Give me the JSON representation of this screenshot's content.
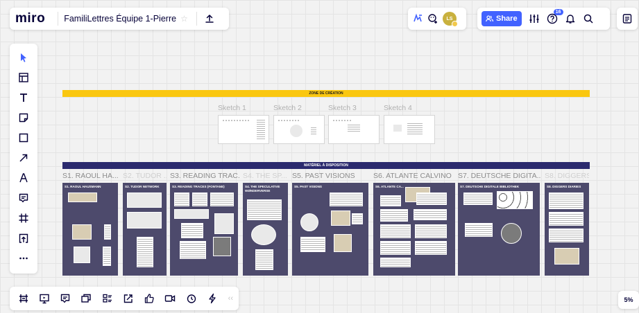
{
  "app": {
    "logo": "miro",
    "board_title": "FamiliLettres Équipe 1-Pierre"
  },
  "header": {
    "avatar_initials": "LS",
    "share_label": "Share",
    "help_badge": "16"
  },
  "toolbar": {
    "tools": [
      "select-icon",
      "templates-icon",
      "text-icon",
      "sticky-note-icon",
      "shape-icon",
      "arrow-icon",
      "pen-icon",
      "comment-icon",
      "frame-icon",
      "upload-icon",
      "more-icon"
    ]
  },
  "bottom_bar": {
    "tools": [
      "frames-icon",
      "presentation-icon",
      "comment-list-icon",
      "cards-icon",
      "kanban-icon",
      "share-screen-icon",
      "like-icon",
      "video-icon",
      "timer-icon",
      "power-icon"
    ],
    "collapse": "‹‹",
    "zoom": "5%"
  },
  "board": {
    "zone_label": "ZONE DE CRÉATION",
    "materiel_label": "MATÉRIEL À DISPOSITION",
    "sketches": [
      {
        "label": "Sketch 1"
      },
      {
        "label": "Sketch 2"
      },
      {
        "label": "Sketch 3"
      },
      {
        "label": "Sketch 4"
      }
    ],
    "sections": [
      {
        "title": "S1. RAOUL HA...",
        "frame_title": "S1. RAOUL HAUSMANN",
        "faded": false
      },
      {
        "title": "S2. TUDOR ...",
        "frame_title": "S2. TUDOR NETWORK",
        "faded": true
      },
      {
        "title": "S3. READING TRAC...",
        "frame_title": "S3. READING TRACES (FONTANE)",
        "faded": false
      },
      {
        "title": "S4. THE SP...",
        "frame_title": "S4. THE SPECULATIVE WØNDERVERSE",
        "faded": true
      },
      {
        "title": "S5. PAST VISIONS",
        "frame_title": "S5. PAST VISIONS",
        "faded": false
      },
      {
        "title": "S6. ATLANTE CALVINO",
        "frame_title": "S6. ATLANTE CA...",
        "faded": false
      },
      {
        "title": "S7. DEUTSCHE DIGITA...",
        "frame_title": "S7. DEUTSCHE DIGITALE BIBLIOTHEK",
        "faded": false
      },
      {
        "title": "S8. DIGGERS...",
        "frame_title": "S8. DIGGERS DIARIES",
        "faded": true
      }
    ]
  },
  "colors": {
    "accent": "#4262ff",
    "zone_bar": "#fac710",
    "materiel_bar": "#2b2a6e",
    "frame": "#4d4a6c",
    "text_dark": "#050038"
  }
}
